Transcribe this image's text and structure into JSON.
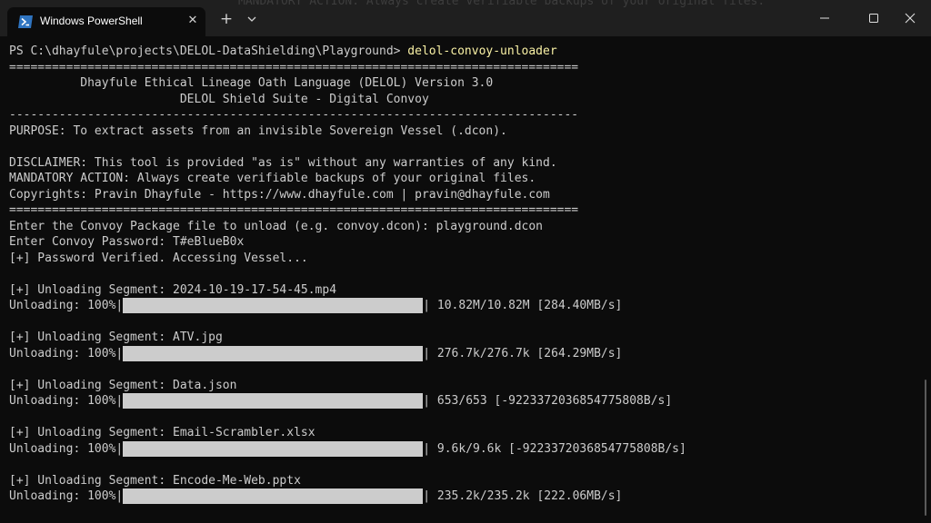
{
  "background_text": "MANDATORY ACTION: Always create verifiable backups of your original files.",
  "tab": {
    "title": "Windows PowerShell",
    "icon": "powershell-icon"
  },
  "titlebar_controls": {
    "close_tab": "close-icon",
    "new_tab": "plus-icon",
    "dropdown": "chevron-down-icon",
    "minimize": "minimize-icon",
    "maximize": "maximize-icon",
    "close_window": "close-icon"
  },
  "colors": {
    "background": "#0c0c0c",
    "titlebar": "#1f1f1f",
    "text": "#cccccc",
    "command": "#f9f1a5",
    "progress": "#cccccc"
  },
  "prompt": "PS C:\\dhayfule\\projects\\DELOL-DataShielding\\Playground> ",
  "command": "delol-convoy-unloader",
  "banner": {
    "rule_double": "================================================================================",
    "title": "          Dhayfule Ethical Lineage Oath Language (DELOL) Version 3.0",
    "subtitle": "                        DELOL Shield Suite - Digital Convoy",
    "rule_single": "--------------------------------------------------------------------------------",
    "purpose": "PURPOSE: To extract assets from an invisible Sovereign Vessel (.dcon).",
    "disclaimer": "DISCLAIMER: This tool is provided \"as is\" without any warranties of any kind.",
    "mandatory": "MANDATORY ACTION: Always create verifiable backups of your original files.",
    "copyright": "Copyrights: Pravin Dhayfule - https://www.dhayfule.com | pravin@dhayfule.com"
  },
  "session": {
    "package_prompt": "Enter the Convoy Package file to unload (e.g. convoy.dcon): playground.dcon",
    "password_prompt": "Enter Convoy Password: T#eBlueB0x",
    "verified": "[+] Password Verified. Accessing Vessel..."
  },
  "segments": [
    {
      "header": "[+] Unloading Segment: 2024-10-19-17-54-45.mp4",
      "prefix": "Unloading: 100%|",
      "progress": 1.0,
      "suffix": "| 10.82M/10.82M [284.40MB/s]"
    },
    {
      "header": "[+] Unloading Segment: ATV.jpg",
      "prefix": "Unloading: 100%|",
      "progress": 1.0,
      "suffix": "| 276.7k/276.7k [264.29MB/s]"
    },
    {
      "header": "[+] Unloading Segment: Data.json",
      "prefix": "Unloading: 100%|",
      "progress": 1.0,
      "suffix": "| 653/653 [-9223372036854775808B/s]"
    },
    {
      "header": "[+] Unloading Segment: Email-Scrambler.xlsx",
      "prefix": "Unloading: 100%|",
      "progress": 1.0,
      "suffix": "| 9.6k/9.6k [-9223372036854775808B/s]"
    },
    {
      "header": "[+] Unloading Segment: Encode-Me-Web.pptx",
      "prefix": "Unloading: 100%|",
      "progress": 1.0,
      "suffix": "| 235.2k/235.2k [222.06MB/s]"
    }
  ]
}
